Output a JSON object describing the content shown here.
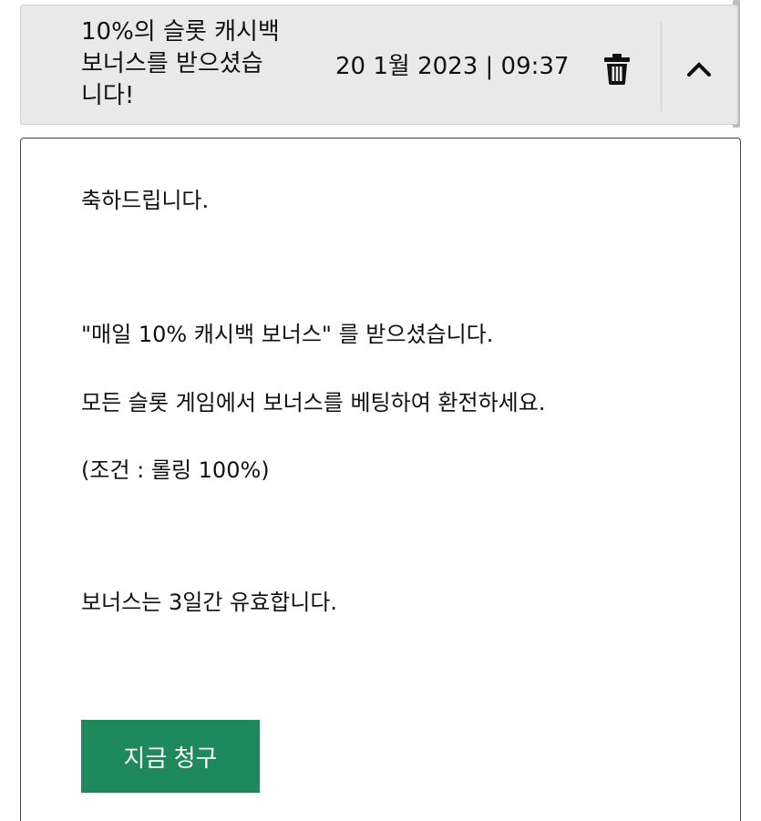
{
  "message": {
    "title": "10%의 슬롯 캐시백\n보너스를 받으셨습\n니다!",
    "date": "20 1월 2023 | 09:37",
    "icons": {
      "delete": "trash-icon",
      "collapse": "chevron-up-icon"
    }
  },
  "body": {
    "greeting": "축하드립니다.",
    "received": "\"매일 10% 캐시백 보너스\" 를 받으셨습니다.",
    "instruction": "모든 슬롯 게임에서 보너스를 베팅하여 환전하세요.",
    "condition": "(조건 : 롤링 100%)",
    "validity": "보너스는 3일간 유효합니다.",
    "claim_label": "지금 청구"
  },
  "colors": {
    "header_bg": "#e9e9e9",
    "button_bg": "#1e8a5c",
    "button_text": "#ffffff"
  }
}
